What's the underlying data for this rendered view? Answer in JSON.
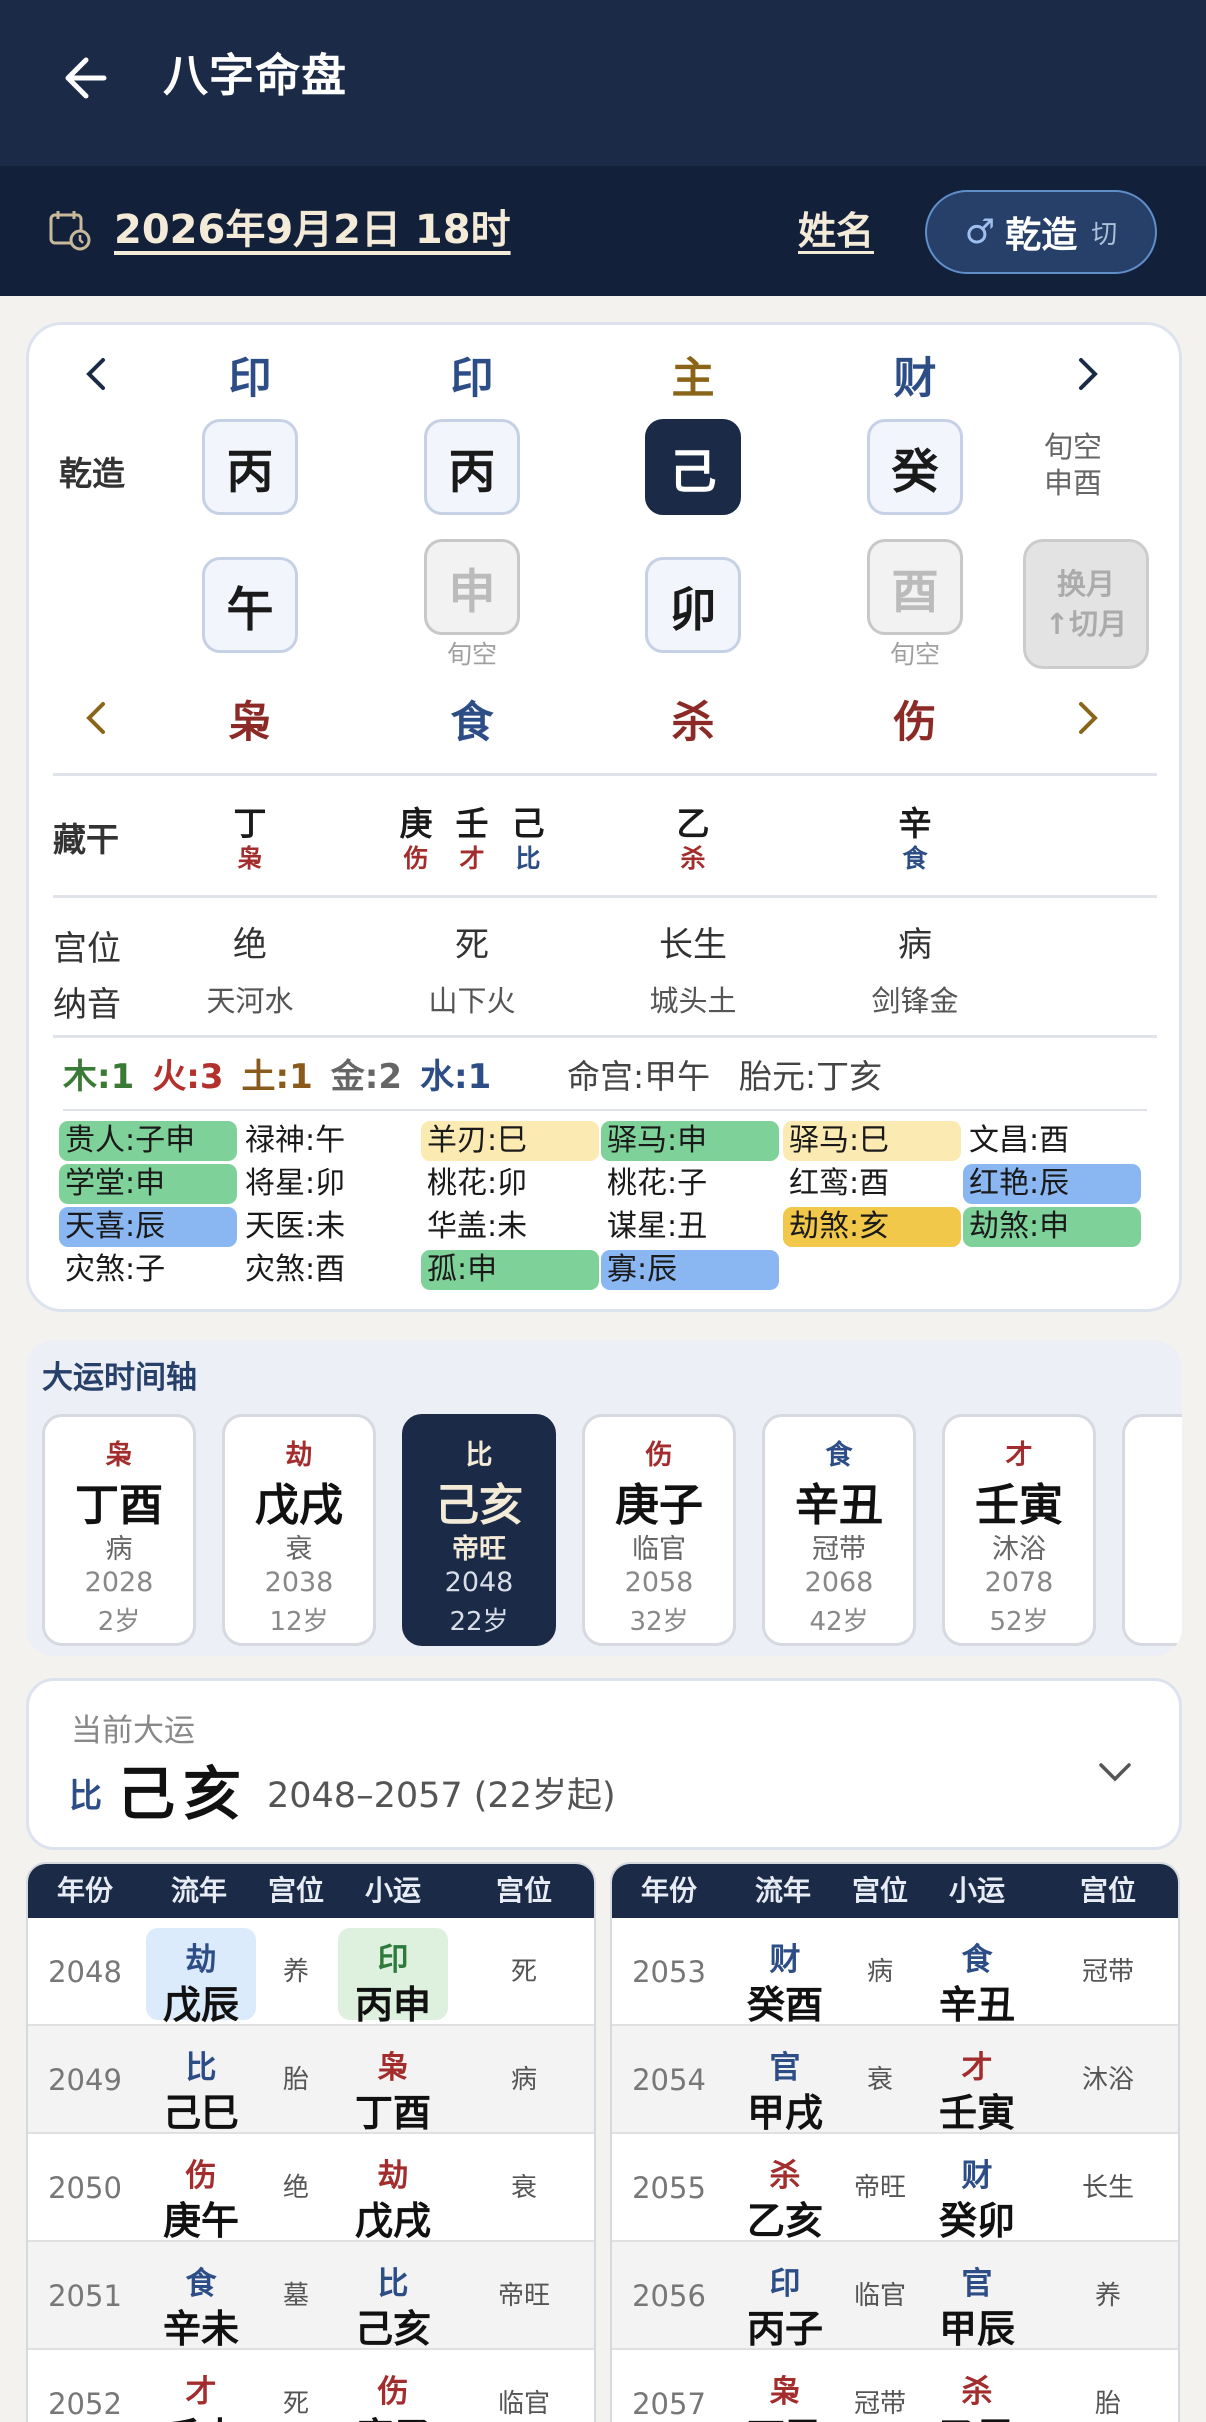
{
  "header": {
    "title": "八字命盘",
    "date": "2026年9月2日 18时",
    "name_label": "姓名",
    "gender_symbol": "♂",
    "gender": "乾造",
    "switch": "切"
  },
  "pillars": {
    "top_gods": [
      {
        "t": "印",
        "c": "#2d4d87"
      },
      {
        "t": "印",
        "c": "#2d4d87"
      },
      {
        "t": "主",
        "c": "#8a6518"
      },
      {
        "t": "财",
        "c": "#2d4d87"
      }
    ],
    "chart_label": "乾造",
    "stems": [
      "丙",
      "丙",
      "己",
      "癸"
    ],
    "branches": [
      "午",
      "申",
      "卯",
      "酉"
    ],
    "void_label": "旬空",
    "void_summary": [
      "旬空",
      "申酉"
    ],
    "change_btn": [
      "换月",
      "↑切月"
    ],
    "bottom_gods": [
      {
        "t": "枭",
        "c": "#8b2a26"
      },
      {
        "t": "食",
        "c": "#2d4d87"
      },
      {
        "t": "杀",
        "c": "#8b2a26"
      },
      {
        "t": "伤",
        "c": "#8b2a26"
      }
    ]
  },
  "hidden": {
    "label": "藏干",
    "groups": [
      [
        {
          "g": "丁",
          "s": "枭",
          "c": "#a32d2d"
        }
      ],
      [
        {
          "g": "庚",
          "s": "伤",
          "c": "#a32d2d"
        },
        {
          "g": "壬",
          "s": "才",
          "c": "#a32d2d"
        },
        {
          "g": "己",
          "s": "比",
          "c": "#2d4d87"
        }
      ],
      [
        {
          "g": "乙",
          "s": "杀",
          "c": "#a32d2d"
        }
      ],
      [
        {
          "g": "辛",
          "s": "食",
          "c": "#2d4d87"
        }
      ]
    ]
  },
  "palace": {
    "label": "宫位",
    "values": [
      "绝",
      "死",
      "长生",
      "病"
    ]
  },
  "nayin": {
    "label": "纳音",
    "values": [
      "天河水",
      "山下火",
      "城头土",
      "剑锋金"
    ]
  },
  "wuxing": [
    {
      "t": "木:1",
      "c": "#3b7a36"
    },
    {
      "t": "火:3",
      "c": "#b3312d"
    },
    {
      "t": "土:1",
      "c": "#8a5a1c"
    },
    {
      "t": "金:2",
      "c": "#666666"
    },
    {
      "t": "水:1",
      "c": "#2d4d87"
    }
  ],
  "minggong": "命宫:甲午",
  "taiyuan": "胎元:丁亥",
  "stars": [
    [
      {
        "t": "贵人:子申",
        "bg": "#7fd19a"
      },
      {
        "t": "禄神:午"
      },
      {
        "t": "羊刃:巳",
        "bg": "#fbeab2"
      },
      {
        "t": "驿马:申",
        "bg": "#7fd19a"
      },
      {
        "t": "驿马:巳",
        "bg": "#fbeab2"
      },
      {
        "t": "文昌:酉"
      }
    ],
    [
      {
        "t": "学堂:申",
        "bg": "#7fd19a"
      },
      {
        "t": "将星:卯"
      },
      {
        "t": "桃花:卯"
      },
      {
        "t": "桃花:子"
      },
      {
        "t": "红鸾:酉"
      },
      {
        "t": "红艳:辰",
        "bg": "#8ab7f2"
      }
    ],
    [
      {
        "t": "天喜:辰",
        "bg": "#8ab7f2"
      },
      {
        "t": "天医:未"
      },
      {
        "t": "华盖:未"
      },
      {
        "t": "谋星:丑"
      },
      {
        "t": "劫煞:亥",
        "bg": "#f1c84a"
      },
      {
        "t": "劫煞:申",
        "bg": "#7fd19a"
      }
    ],
    [
      {
        "t": "灾煞:子"
      },
      {
        "t": "灾煞:酉"
      },
      {
        "t": "孤:申",
        "bg": "#7fd19a"
      },
      {
        "t": "寡:辰",
        "bg": "#8ab7f2"
      }
    ]
  ],
  "timeline": {
    "title": "大运时间轴",
    "items": [
      {
        "god": "枭",
        "gc": "#a32d2d",
        "gz": "丁酉",
        "st": "病",
        "yr": "2028",
        "age": "2岁"
      },
      {
        "god": "劫",
        "gc": "#a32d2d",
        "gz": "戊戌",
        "st": "衰",
        "yr": "2038",
        "age": "12岁"
      },
      {
        "god": "比",
        "gc": "#2d4d87",
        "gz": "己亥",
        "st": "帝旺",
        "yr": "2048",
        "age": "22岁",
        "cur": true
      },
      {
        "god": "伤",
        "gc": "#a32d2d",
        "gz": "庚子",
        "st": "临官",
        "yr": "2058",
        "age": "32岁"
      },
      {
        "god": "食",
        "gc": "#2d4d87",
        "gz": "辛丑",
        "st": "冠带",
        "yr": "2068",
        "age": "42岁"
      },
      {
        "god": "才",
        "gc": "#a32d2d",
        "gz": "壬寅",
        "st": "沐浴",
        "yr": "2078",
        "age": "52岁"
      }
    ]
  },
  "current": {
    "label": "当前大运",
    "god": "比",
    "gz": "己亥",
    "range": "2048–2057 (22岁起)"
  },
  "table": {
    "headers": [
      "年份",
      "流年",
      "宫位",
      "小运",
      "宫位"
    ],
    "left": [
      {
        "y": "2048",
        "ls": "劫",
        "lsc": "#2d4d87",
        "lg": "戊辰",
        "lhl": "hb",
        "p1": "养",
        "xs": "印",
        "xsc": "#2d7a3c",
        "xg": "丙申",
        "xhl": "hg",
        "p2": "死"
      },
      {
        "y": "2049",
        "ls": "比",
        "lsc": "#2d4d87",
        "lg": "己巳",
        "p1": "胎",
        "xs": "枭",
        "xsc": "#a32d2d",
        "xg": "丁酉",
        "p2": "病"
      },
      {
        "y": "2050",
        "ls": "伤",
        "lsc": "#a32d2d",
        "lg": "庚午",
        "p1": "绝",
        "xs": "劫",
        "xsc": "#a32d2d",
        "xg": "戊戌",
        "p2": "衰"
      },
      {
        "y": "2051",
        "ls": "食",
        "lsc": "#2d4d87",
        "lg": "辛未",
        "p1": "墓",
        "xs": "比",
        "xsc": "#2d4d87",
        "xg": "己亥",
        "p2": "帝旺"
      },
      {
        "y": "2052",
        "ls": "才",
        "lsc": "#a32d2d",
        "lg": "壬申",
        "p1": "死",
        "xs": "伤",
        "xsc": "#a32d2d",
        "xg": "庚子",
        "p2": "临官"
      }
    ],
    "right": [
      {
        "y": "2053",
        "ls": "财",
        "lsc": "#2d4d87",
        "lg": "癸酉",
        "p1": "病",
        "xs": "食",
        "xsc": "#2d4d87",
        "xg": "辛丑",
        "p2": "冠带"
      },
      {
        "y": "2054",
        "ls": "官",
        "lsc": "#2d4d87",
        "lg": "甲戌",
        "p1": "衰",
        "xs": "才",
        "xsc": "#a32d2d",
        "xg": "壬寅",
        "p2": "沐浴"
      },
      {
        "y": "2055",
        "ls": "杀",
        "lsc": "#a32d2d",
        "lg": "乙亥",
        "p1": "帝旺",
        "xs": "财",
        "xsc": "#2d4d87",
        "xg": "癸卯",
        "p2": "长生"
      },
      {
        "y": "2056",
        "ls": "印",
        "lsc": "#2d4d87",
        "lg": "丙子",
        "p1": "临官",
        "xs": "官",
        "xsc": "#2d4d87",
        "xg": "甲辰",
        "p2": "养"
      },
      {
        "y": "2057",
        "ls": "枭",
        "lsc": "#a32d2d",
        "lg": "丁丑",
        "p1": "冠带",
        "xs": "杀",
        "xsc": "#a32d2d",
        "xg": "乙巳",
        "p2": "胎"
      }
    ]
  }
}
